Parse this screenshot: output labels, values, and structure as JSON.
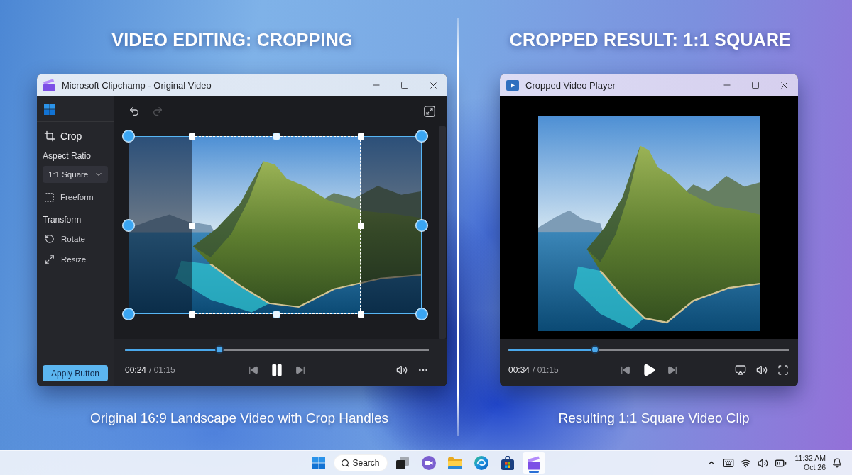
{
  "left_panel": {
    "heading": "VIDEO EDITING: CROPPING",
    "window": {
      "title": "Microsoft Clipchamp - Original Video",
      "sidebar": {
        "tool": "Crop",
        "aspect_ratio": {
          "label": "Aspect Ratio",
          "value": "1:1 Square"
        },
        "freeform": {
          "label": "Freeform",
          "checked": false
        },
        "transform": {
          "label": "Transform",
          "actions": [
            "Rotate",
            "Resize"
          ]
        },
        "apply_button": "Apply Button"
      },
      "toolbar": {
        "undo": {
          "disabled": false
        },
        "redo": {
          "disabled": true
        }
      },
      "player": {
        "playing": true,
        "progress": {
          "level": 0.31
        },
        "elapsed": "00:24",
        "total": "/ 01:15"
      }
    },
    "caption": "Original 16:9 Landscape Video with Crop Handles"
  },
  "right_panel": {
    "heading": "CROPPED RESULT: 1:1 SQUARE",
    "window": {
      "title": "Cropped Video Player",
      "player": {
        "playing": false,
        "progress": {
          "level": 0.31
        },
        "elapsed": "00:34",
        "total": "/ 01:15"
      }
    },
    "caption": "Resulting 1:1 Square Video Clip"
  },
  "taskbar": {
    "search": {
      "placeholder": "Search"
    },
    "apps": [
      {
        "selected": false
      },
      {
        "selected": false
      },
      {
        "selected": false
      },
      {
        "selected": false
      },
      {
        "selected": false
      },
      {
        "selected": true
      }
    ],
    "clock": {
      "time": "11:32 AM",
      "date": "Oct 26"
    }
  }
}
